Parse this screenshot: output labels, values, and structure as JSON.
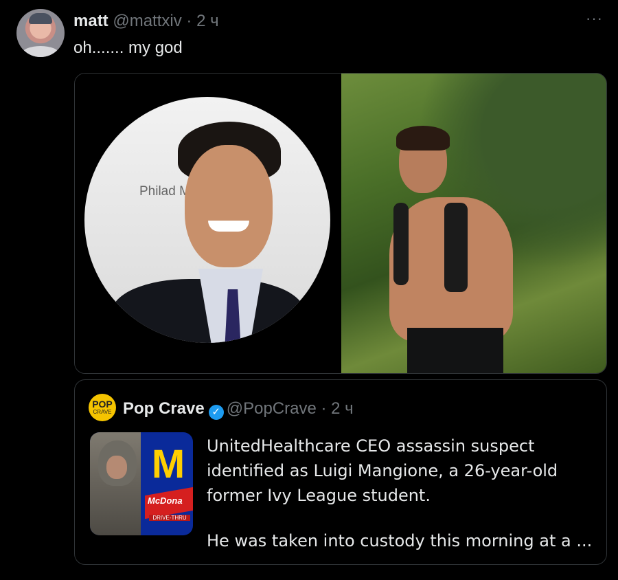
{
  "tweet": {
    "display_name": "matt",
    "handle": "@mattxiv",
    "separator": "·",
    "time": "2 ч",
    "text": "oh....... my god",
    "more": "···"
  },
  "quote": {
    "avatar_text_top": "POP",
    "avatar_text_bottom": "CRAVE",
    "display_name": "Pop Crave",
    "verified": "✓",
    "handle": "@PopCrave",
    "separator": "·",
    "time": "2 ч",
    "paragraph1": "UnitedHealthcare CEO assassin suspect identified as Luigi Mangione, a 26-year-old former Ivy League student.",
    "paragraph2": "He was taken into custody this morning at a ...",
    "thumb_logo": "McDona",
    "thumb_drive": "DRIVE-THRU",
    "thumb_m": "M"
  },
  "media": {
    "left_photo_sign": "Philad Muse"
  },
  "colors": {
    "background": "#000000",
    "text_primary": "#e7e9ea",
    "text_secondary": "#71767b",
    "border": "#2f3336",
    "verified_blue": "#1d9bf0",
    "pop_yellow": "#f5c400"
  }
}
